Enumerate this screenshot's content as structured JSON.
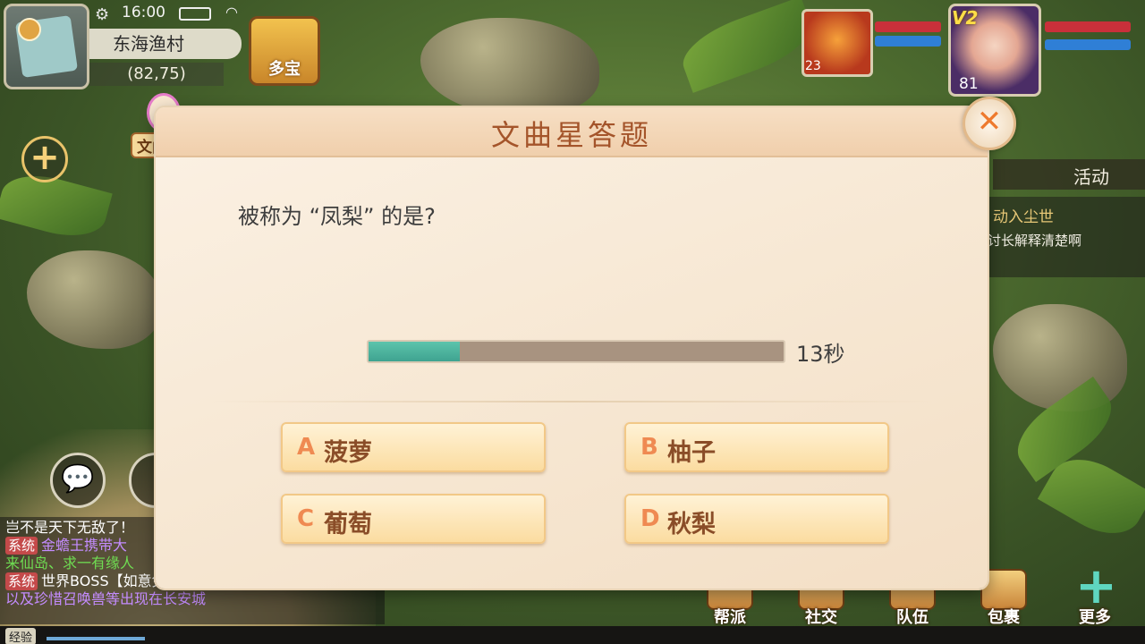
{
  "status": {
    "time": "16:00"
  },
  "location": {
    "name": "东海渔村",
    "coords": "(82,75)"
  },
  "shortcuts": {
    "duobao": "多宝",
    "npc": "文曲星"
  },
  "pet": {
    "level": "23"
  },
  "hero": {
    "level": "81",
    "vip": "V2"
  },
  "side_panel": {
    "activity_tab": "活动",
    "task_title": "动入尘世",
    "task_desc": "讨长解释清楚啊"
  },
  "chat": {
    "lines": [
      {
        "text": "岂不是天下无敌了！"
      },
      {
        "tag": "系统",
        "text": "金蟾王携带大",
        "tail": ""
      },
      {
        "text": "来仙岛、求一有缘人"
      },
      {
        "tag": "系统",
        "text": "世界BOSS【如意兔】携带大量物资"
      },
      {
        "text": "以及珍惜召唤兽等出现在长安城"
      }
    ]
  },
  "exp": {
    "label": "经验",
    "progress": 0.086
  },
  "menu": {
    "items": [
      "帮派",
      "社交",
      "队伍",
      "包裹",
      "更多"
    ]
  },
  "quiz": {
    "title": "文曲星答题",
    "question": "被称为 “凤梨” 的是?",
    "time_left": "13秒",
    "time_progress": 0.22,
    "options": [
      {
        "letter": "A",
        "text": "菠萝"
      },
      {
        "letter": "B",
        "text": "柚子"
      },
      {
        "letter": "C",
        "text": "葡萄"
      },
      {
        "letter": "D",
        "text": "秋梨"
      }
    ]
  },
  "colors": {
    "accent": "#ef8a52",
    "timer": "#4fb39e",
    "title": "#a4542a"
  }
}
